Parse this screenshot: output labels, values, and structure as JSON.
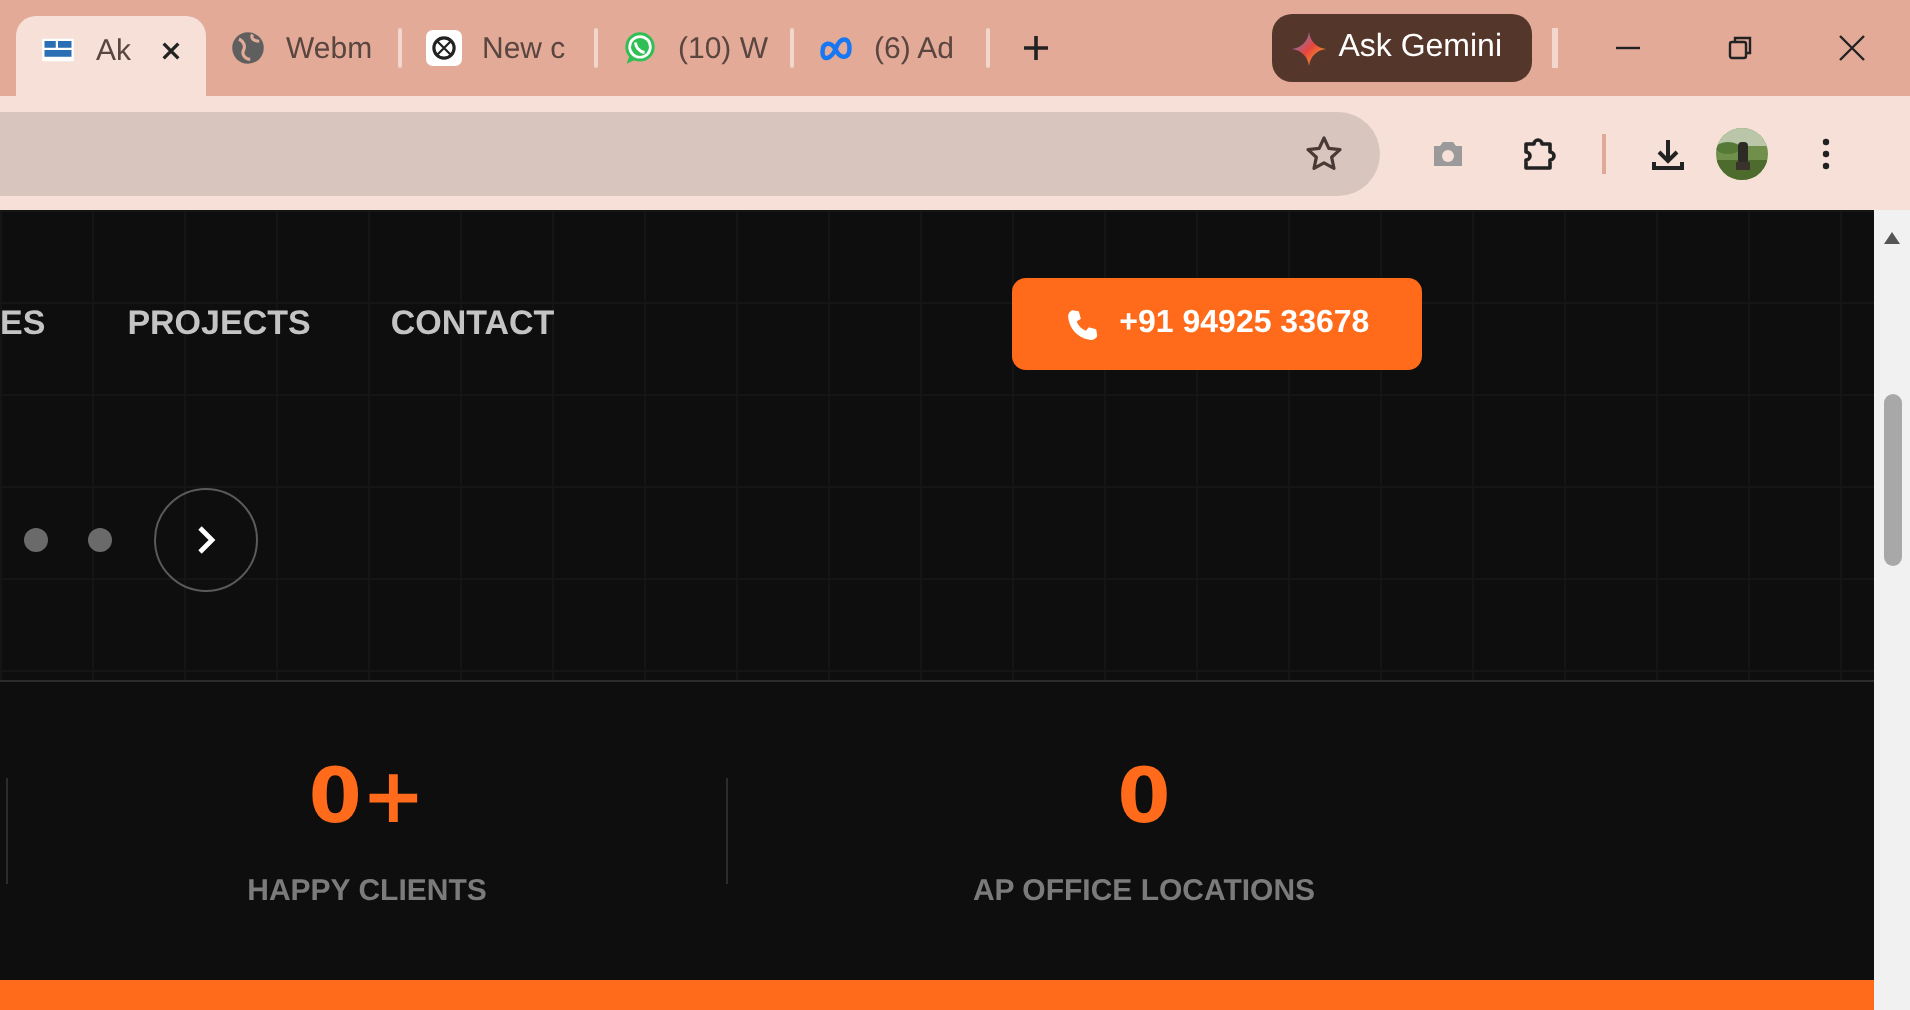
{
  "browser": {
    "tabs": [
      {
        "title": "Ak",
        "kind": "site",
        "selected": true
      },
      {
        "title": "Webm",
        "kind": "globe",
        "selected": false
      },
      {
        "title": "New c",
        "kind": "chat",
        "selected": false
      },
      {
        "title": "(10) W",
        "kind": "whatsapp",
        "selected": false
      },
      {
        "title": "(6) Ad",
        "kind": "meta",
        "selected": false
      }
    ],
    "gemini_button": "Ask Gemini"
  },
  "page": {
    "nav": [
      "ES",
      "PROJECTS",
      "CONTACT"
    ],
    "phone_button": "+91 94925 33678",
    "carousel_dots": [
      {
        "selected": false
      },
      {
        "selected": false
      }
    ],
    "stats": [
      {
        "value": "0+",
        "label": "HAPPY CLIENTS"
      },
      {
        "value": "0",
        "label": "AP OFFICE LOCATIONS"
      }
    ]
  }
}
